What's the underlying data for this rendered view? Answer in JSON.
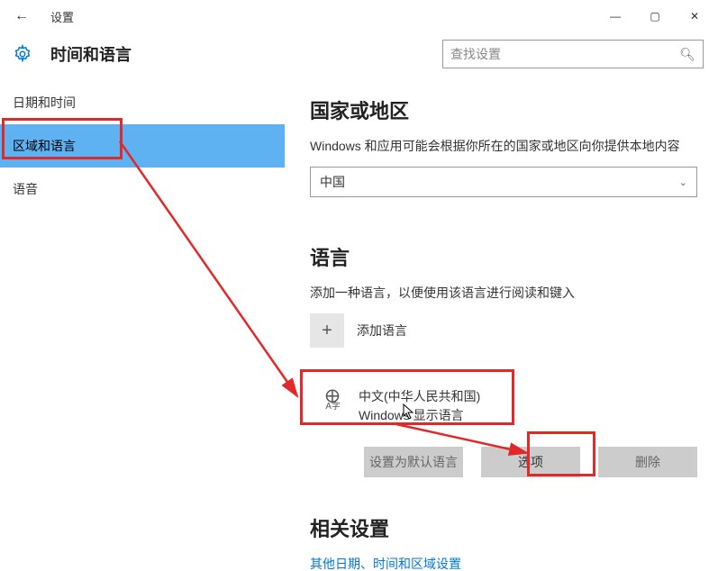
{
  "titlebar": {
    "back": "←",
    "title": "设置",
    "min": "—",
    "max": "▢",
    "close": "✕"
  },
  "header": {
    "page_title": "时间和语言",
    "search_placeholder": "查找设置",
    "search_icon": "🔍"
  },
  "sidebar": {
    "items": [
      {
        "label": "日期和时间"
      },
      {
        "label": "区域和语言"
      },
      {
        "label": "语音"
      }
    ]
  },
  "region": {
    "heading": "国家或地区",
    "desc": "Windows 和应用可能会根据你所在的国家或地区向你提供本地内容",
    "selected": "中国"
  },
  "language": {
    "heading": "语言",
    "desc": "添加一种语言，以便使用该语言进行阅读和键入",
    "add_label": "添加语言",
    "items": [
      {
        "name": "中文(中华人民共和国)",
        "sub": "Windows 显示语言"
      }
    ],
    "btn_default": "设置为默认语言",
    "btn_options": "选项",
    "btn_remove": "删除"
  },
  "related": {
    "heading": "相关设置",
    "link": "其他日期、时间和区域设置"
  }
}
